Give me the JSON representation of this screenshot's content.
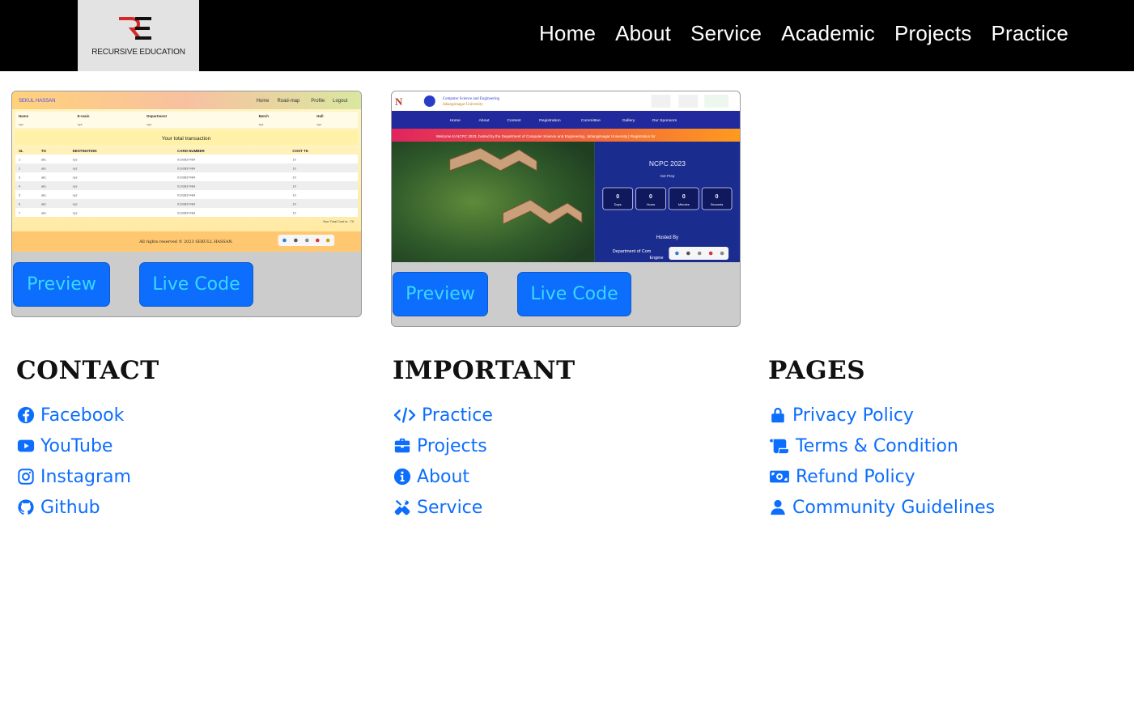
{
  "brand": {
    "name": "RECURSIVE EDUCATION",
    "logo_letters": "RE",
    "logo_colors": [
      "#d62828",
      "#111111"
    ]
  },
  "nav": [
    {
      "label": "Home"
    },
    {
      "label": "About"
    },
    {
      "label": "Service"
    },
    {
      "label": "Academic"
    },
    {
      "label": "Projects"
    },
    {
      "label": "Practice"
    }
  ],
  "projects": [
    {
      "preview_label": "Preview",
      "live_label": "Live Code",
      "thumb": {
        "site_name": "SEKUL HASSAN",
        "menu": [
          "Home",
          "Road-map",
          "Profile",
          "Logout"
        ],
        "profile_headers": [
          "Name",
          "E-main",
          "Department",
          "Batch",
          "Hall"
        ],
        "profile_values": [
          "xyz",
          "xyz",
          "xyz",
          "xyz",
          "xyz"
        ],
        "section_title": "Your total transaction",
        "table_headers": [
          "SL",
          "TO",
          "DESTINATION",
          "CARD NUMBER",
          "COST TK"
        ],
        "rows": [
          [
            "1",
            "abc",
            "xyz",
            "0193837484",
            "10"
          ],
          [
            "2",
            "abc",
            "xyz",
            "0193837484",
            "10"
          ],
          [
            "3",
            "abc",
            "xyz",
            "0193837484",
            "10"
          ],
          [
            "4",
            "abc",
            "xyz",
            "0193837484",
            "10"
          ],
          [
            "5",
            "abc",
            "xyz",
            "0193837484",
            "10"
          ],
          [
            "6",
            "abc",
            "xyz",
            "0193837484",
            "10"
          ],
          [
            "7",
            "abc",
            "xyz",
            "0193837484",
            "10"
          ]
        ],
        "total": "Your Total Cost is : 70",
        "footer": "All rights reserved © 2023 SEKULL HASSAN."
      }
    },
    {
      "preview_label": "Preview",
      "live_label": "Live Code",
      "thumb": {
        "dept_line1": "Computer Science and Engineering",
        "dept_line2": "Jahangirnagar University",
        "menu": [
          "Home",
          "About",
          "Contest",
          "Registration",
          "Committee",
          "Gallery",
          "Our Sponsors"
        ],
        "marquee": "Welcome to NCPC 2023, hosted by the Department of Computer Science and Engineering, Jahangirnagar University | Registration for",
        "event_title": "NCPC 2023",
        "event_sub": "Get Prep",
        "countdown": [
          {
            "value": "0",
            "unit": "Days"
          },
          {
            "value": "0",
            "unit": "Hours"
          },
          {
            "value": "0",
            "unit": "Minutes"
          },
          {
            "value": "0",
            "unit": "Seconds"
          }
        ],
        "hosted_by": "Hosted By",
        "host_name": "Department of Com",
        "host_name2": "Engine"
      }
    }
  ],
  "footer": {
    "contact": {
      "title": "CONTACT",
      "links": [
        {
          "label": "Facebook",
          "icon": "facebook-icon"
        },
        {
          "label": "YouTube",
          "icon": "youtube-icon"
        },
        {
          "label": "Instagram",
          "icon": "instagram-icon"
        },
        {
          "label": "Github",
          "icon": "github-icon"
        }
      ]
    },
    "important": {
      "title": "IMPORTANT",
      "links": [
        {
          "label": "Practice",
          "icon": "code-icon"
        },
        {
          "label": "Projects",
          "icon": "briefcase-icon"
        },
        {
          "label": "About",
          "icon": "info-icon"
        },
        {
          "label": "Service",
          "icon": "tools-icon"
        }
      ]
    },
    "pages": {
      "title": "PAGES",
      "links": [
        {
          "label": "Privacy Policy",
          "icon": "lock-icon"
        },
        {
          "label": "Terms & Condition",
          "icon": "scroll-icon"
        },
        {
          "label": "Refund Policy",
          "icon": "money-bill-icon"
        },
        {
          "label": "Community Guidelines",
          "icon": "user-icon"
        }
      ]
    }
  },
  "colors": {
    "link": "#0d6efd",
    "button": "#0d6efd",
    "button_text": "#39d8ff",
    "nav_bg": "#000000"
  }
}
